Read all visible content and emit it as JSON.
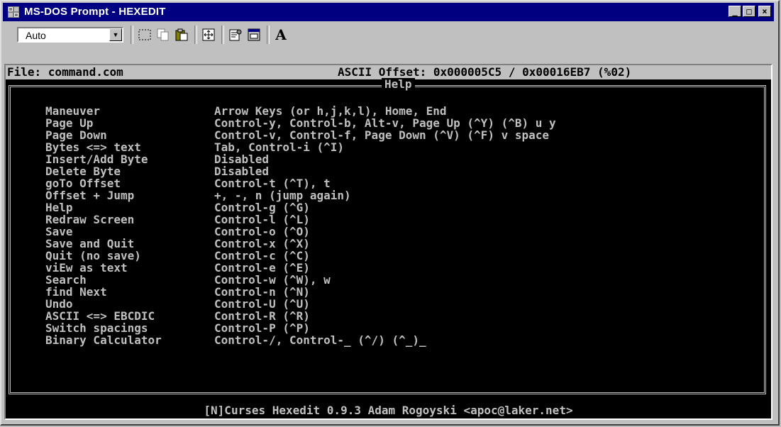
{
  "window": {
    "title": "MS-DOS Prompt - HEXEDIT"
  },
  "window_controls": {
    "minimize": "_",
    "maximize": "□",
    "close": "×"
  },
  "toolbar": {
    "font_size_value": "Auto",
    "bold_label": "A"
  },
  "status": {
    "file": "File: command.com",
    "offset": "ASCII Offset: 0x000005C5 / 0x00016EB7 (%02)"
  },
  "help": {
    "title": "Help",
    "rows": [
      {
        "key": "Maneuver",
        "value": "Arrow Keys (or h,j,k,l), Home, End"
      },
      {
        "key": "Page Up",
        "value": "Control-y, Control-b, Alt-v, Page Up (^Y) (^B) u y"
      },
      {
        "key": "Page Down",
        "value": "Control-v, Control-f, Page Down (^V) (^F) v space"
      },
      {
        "key": "Bytes <=> text",
        "value": "Tab, Control-i (^I)"
      },
      {
        "key": "Insert/Add Byte",
        "value": "Disabled"
      },
      {
        "key": "Delete Byte",
        "value": "Disabled"
      },
      {
        "key": "goTo Offset",
        "value": "Control-t (^T), t"
      },
      {
        "key": "Offset + Jump",
        "value": "+, -, n (jump again)"
      },
      {
        "key": "Help",
        "value": "Control-g (^G)"
      },
      {
        "key": "Redraw Screen",
        "value": "Control-l (^L)"
      },
      {
        "key": "Save",
        "value": "Control-o (^O)"
      },
      {
        "key": "Save and Quit",
        "value": "Control-x (^X)"
      },
      {
        "key": "Quit (no save)",
        "value": "Control-c (^C)"
      },
      {
        "key": "viEw as text",
        "value": "Control-e (^E)"
      },
      {
        "key": "Search",
        "value": "Control-w (^W), w"
      },
      {
        "key": "find Next",
        "value": "Control-n (^N)"
      },
      {
        "key": "Undo",
        "value": "Control-U (^U)"
      },
      {
        "key": "ASCII <=> EBCDIC",
        "value": "Control-R (^R)"
      },
      {
        "key": "Switch spacings",
        "value": "Control-P (^P)"
      },
      {
        "key": "Binary Calculator",
        "value": "Control-/, Control-_ (^/) (^_)_"
      }
    ]
  },
  "footer": "[N]Curses Hexedit 0.9.3 Adam Rogoyski <apoc@laker.net>",
  "colors": {
    "titlebar": "#000080",
    "console_bg": "#000000",
    "console_fg": "#c0c0c0",
    "status_bg": "#c0c0c0"
  },
  "icons": [
    "msdos-app-icon",
    "mark-icon",
    "copy-icon",
    "paste-icon",
    "fullscreen-icon",
    "properties-icon",
    "background-icon",
    "font-icon"
  ]
}
